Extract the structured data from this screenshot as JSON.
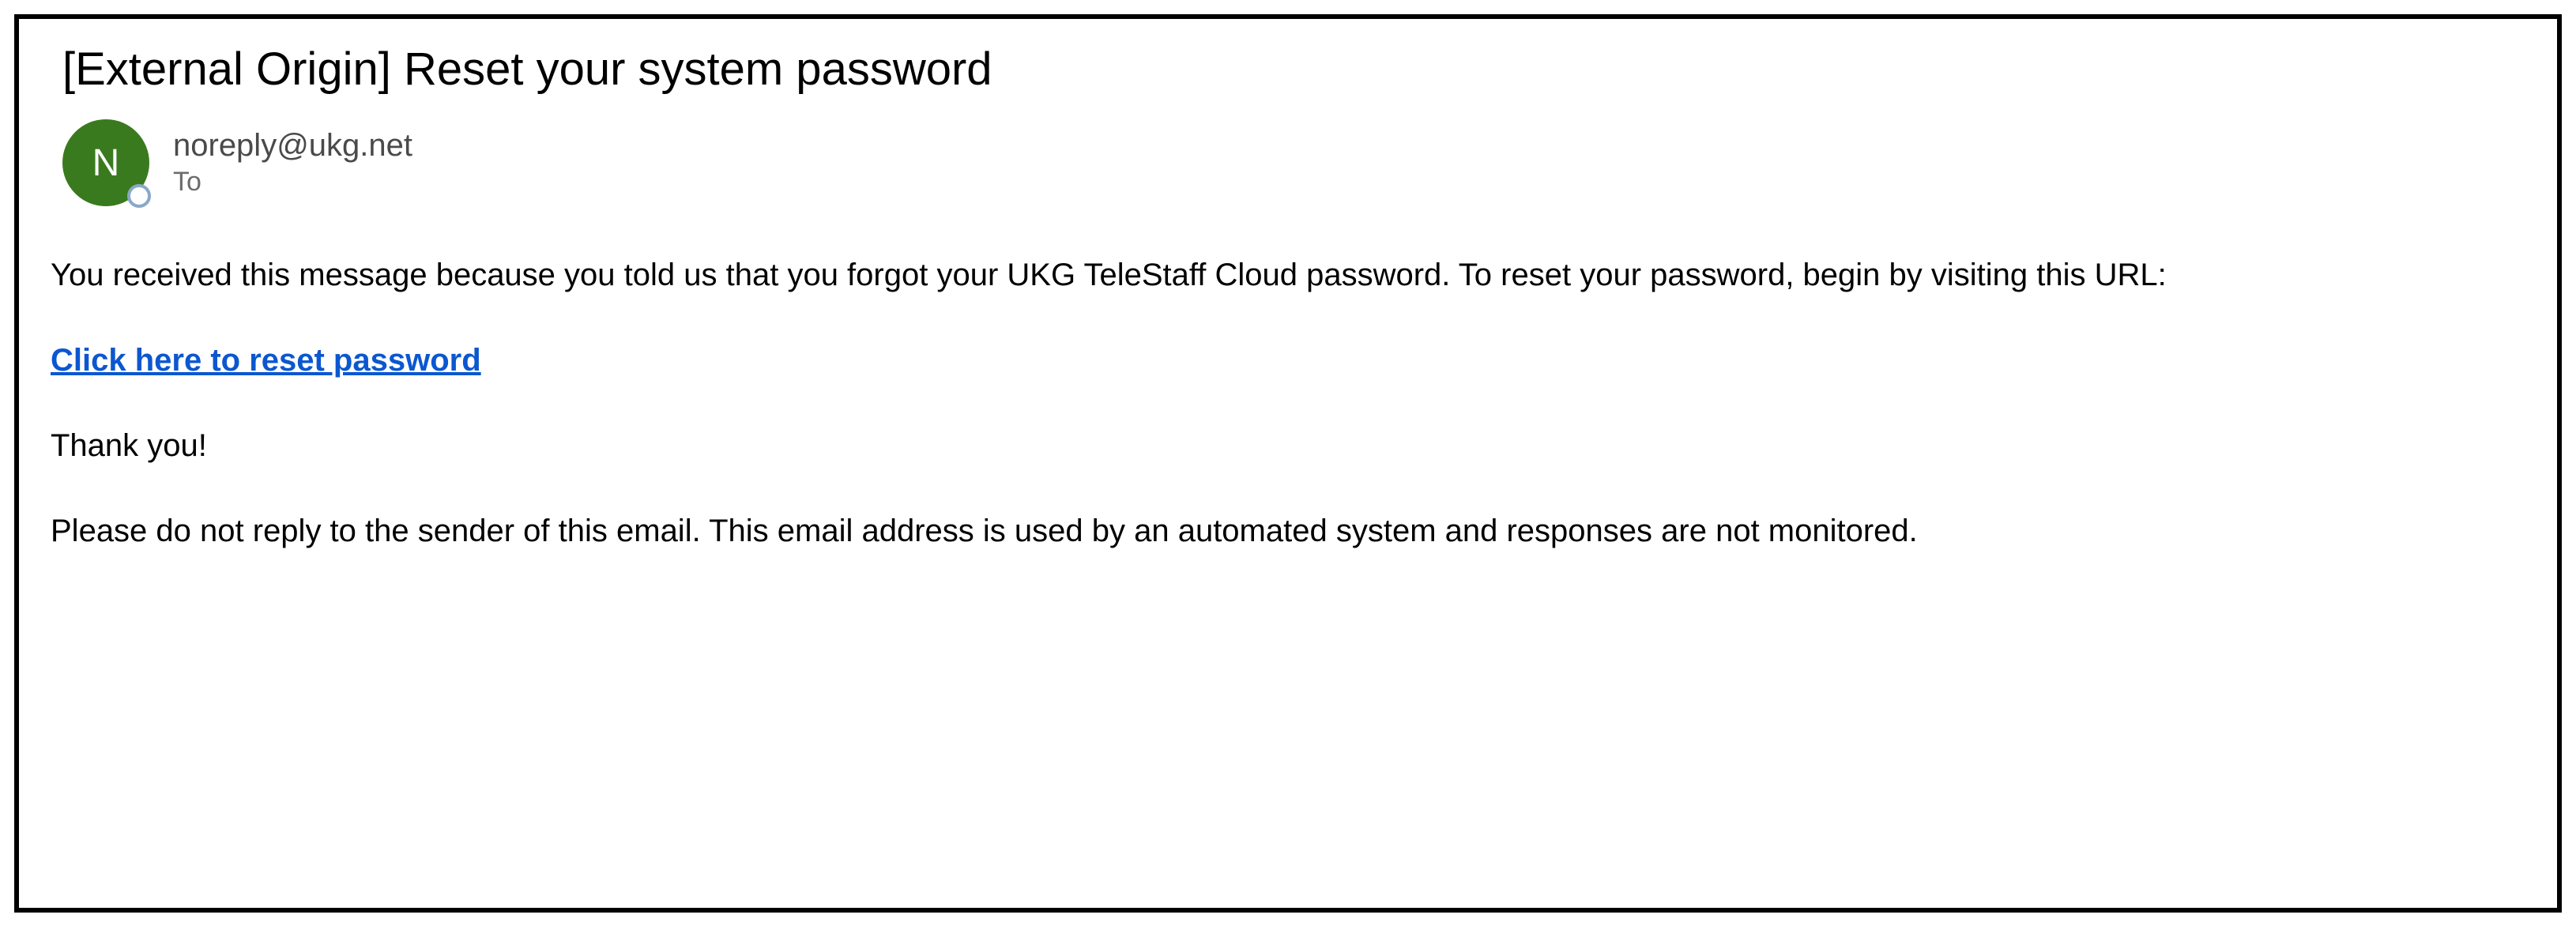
{
  "email": {
    "subject": "[External Origin] Reset your system password",
    "sender": {
      "initial": "N",
      "address": "noreply@ukg.net",
      "to_label": "To"
    },
    "body": {
      "intro": "You received this message because you told us that you forgot your UKG TeleStaff Cloud password. To reset your password, begin by visiting this URL:",
      "link_text": "Click here to reset password",
      "thanks": "Thank you!",
      "footer": "Please do not reply to the sender of this email. This email address is used by an automated system and responses are not monitored."
    }
  },
  "colors": {
    "avatar_bg": "#3a7a1e",
    "link": "#0b57d0"
  }
}
